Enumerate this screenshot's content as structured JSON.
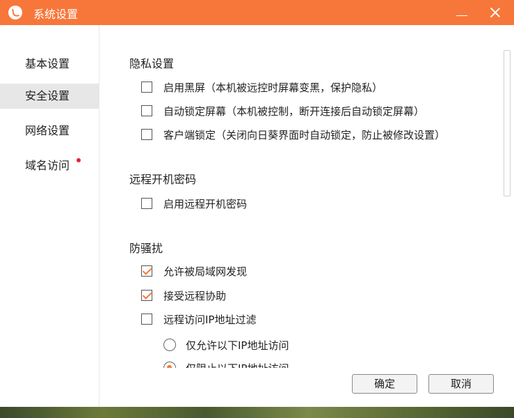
{
  "window": {
    "title": "系统设置",
    "logo_icon": "sunflower-logo-icon",
    "accent_color": "#f7773a"
  },
  "sidebar": {
    "items": [
      {
        "label": "基本设置",
        "active": false,
        "badge": false
      },
      {
        "label": "安全设置",
        "active": true,
        "badge": false
      },
      {
        "label": "网络设置",
        "active": false,
        "badge": false
      },
      {
        "label": "域名访问",
        "active": false,
        "badge": true
      }
    ]
  },
  "sections": {
    "privacy": {
      "title": "隐私设置",
      "options": [
        {
          "label": "启用黑屏（本机被远控时屏幕变黑，保护隐私）",
          "checked": false
        },
        {
          "label": "自动锁定屏幕（本机被控制，断开连接后自动锁定屏幕）",
          "checked": false
        },
        {
          "label": "客户端锁定（关闭向日葵界面时自动锁定，防止被修改设置）",
          "checked": false
        }
      ]
    },
    "remote_boot": {
      "title": "远程开机密码",
      "options": [
        {
          "label": "启用远程开机密码",
          "checked": false
        }
      ]
    },
    "anti_harass": {
      "title": "防骚扰",
      "options": [
        {
          "label": "允许被局域网发现",
          "checked": true
        },
        {
          "label": "接受远程协助",
          "checked": true
        },
        {
          "label": "远程访问IP地址过滤",
          "checked": false
        }
      ],
      "radios": [
        {
          "label": "仅允许以下IP地址访问",
          "selected": false
        },
        {
          "label": "仅阻止以下IP地址访问",
          "selected": true
        }
      ]
    }
  },
  "footer": {
    "ok_label": "确定",
    "cancel_label": "取消"
  }
}
